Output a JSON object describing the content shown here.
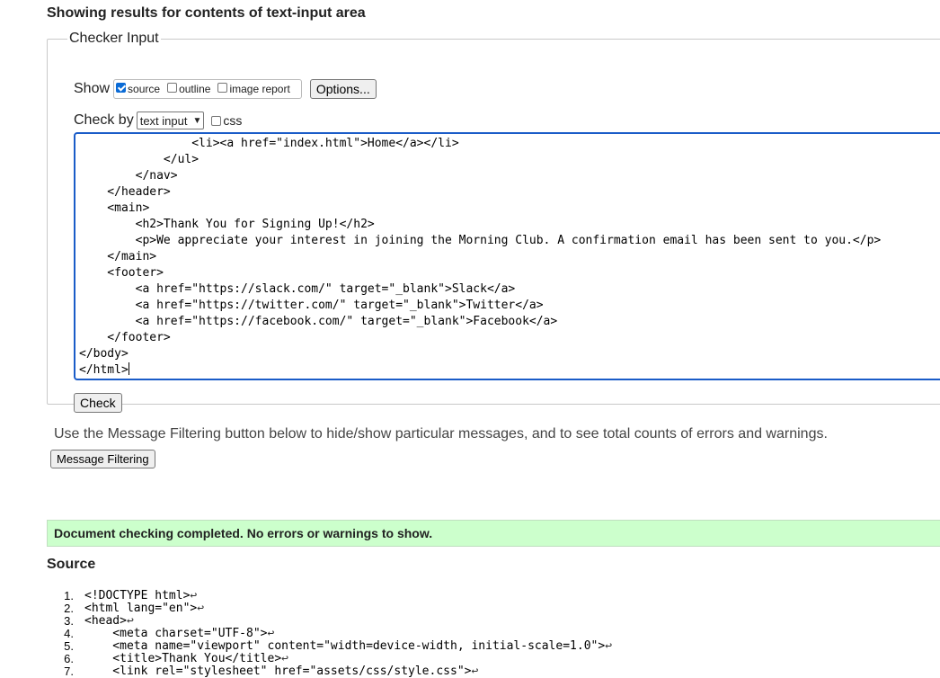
{
  "heading": "Showing results for contents of text-input area",
  "checker": {
    "legend": "Checker Input",
    "show_label": "Show",
    "options": [
      {
        "label": "source",
        "checked": true
      },
      {
        "label": "outline",
        "checked": false
      },
      {
        "label": "image report",
        "checked": false
      }
    ],
    "options_button": "Options...",
    "check_by_label": "Check by",
    "check_by_value": "text input",
    "css_label": "css",
    "css_checked": false,
    "textarea_content": "                <li><a href=\"index.html\">Home</a></li>\n            </ul>\n        </nav>\n    </header>\n    <main>\n        <h2>Thank You for Signing Up!</h2>\n        <p>We appreciate your interest in joining the Morning Club. A confirmation email has been sent to you.</p>\n    </main>\n    <footer>\n        <a href=\"https://slack.com/\" target=\"_blank\">Slack</a>\n        <a href=\"https://twitter.com/\" target=\"_blank\">Twitter</a>\n        <a href=\"https://facebook.com/\" target=\"_blank\">Facebook</a>\n    </footer>\n</body>\n</html>",
    "check_button": "Check"
  },
  "filter_info": "Use the Message Filtering button below to hide/show particular messages, and to see total counts of errors and warnings.",
  "filter_button": "Message Filtering",
  "status_message": "Document checking completed. No errors or warnings to show.",
  "source": {
    "title": "Source",
    "lines": [
      {
        "num": "1.",
        "code": "<!DOCTYPE html>"
      },
      {
        "num": "2.",
        "code": "<html lang=\"en\">"
      },
      {
        "num": "3.",
        "code": "<head>"
      },
      {
        "num": "4.",
        "code": "    <meta charset=\"UTF-8\">"
      },
      {
        "num": "5.",
        "code": "    <meta name=\"viewport\" content=\"width=device-width, initial-scale=1.0\">"
      },
      {
        "num": "6.",
        "code": "    <title>Thank You</title>"
      },
      {
        "num": "7.",
        "code": "    <link rel=\"stylesheet\" href=\"assets/css/style.css\">"
      }
    ],
    "newline_symbol": "↩"
  },
  "colors": {
    "success_bg": "#ccffcc",
    "focus_border": "#1a5cc8",
    "checkbox_checked": "#0b6bd6"
  }
}
